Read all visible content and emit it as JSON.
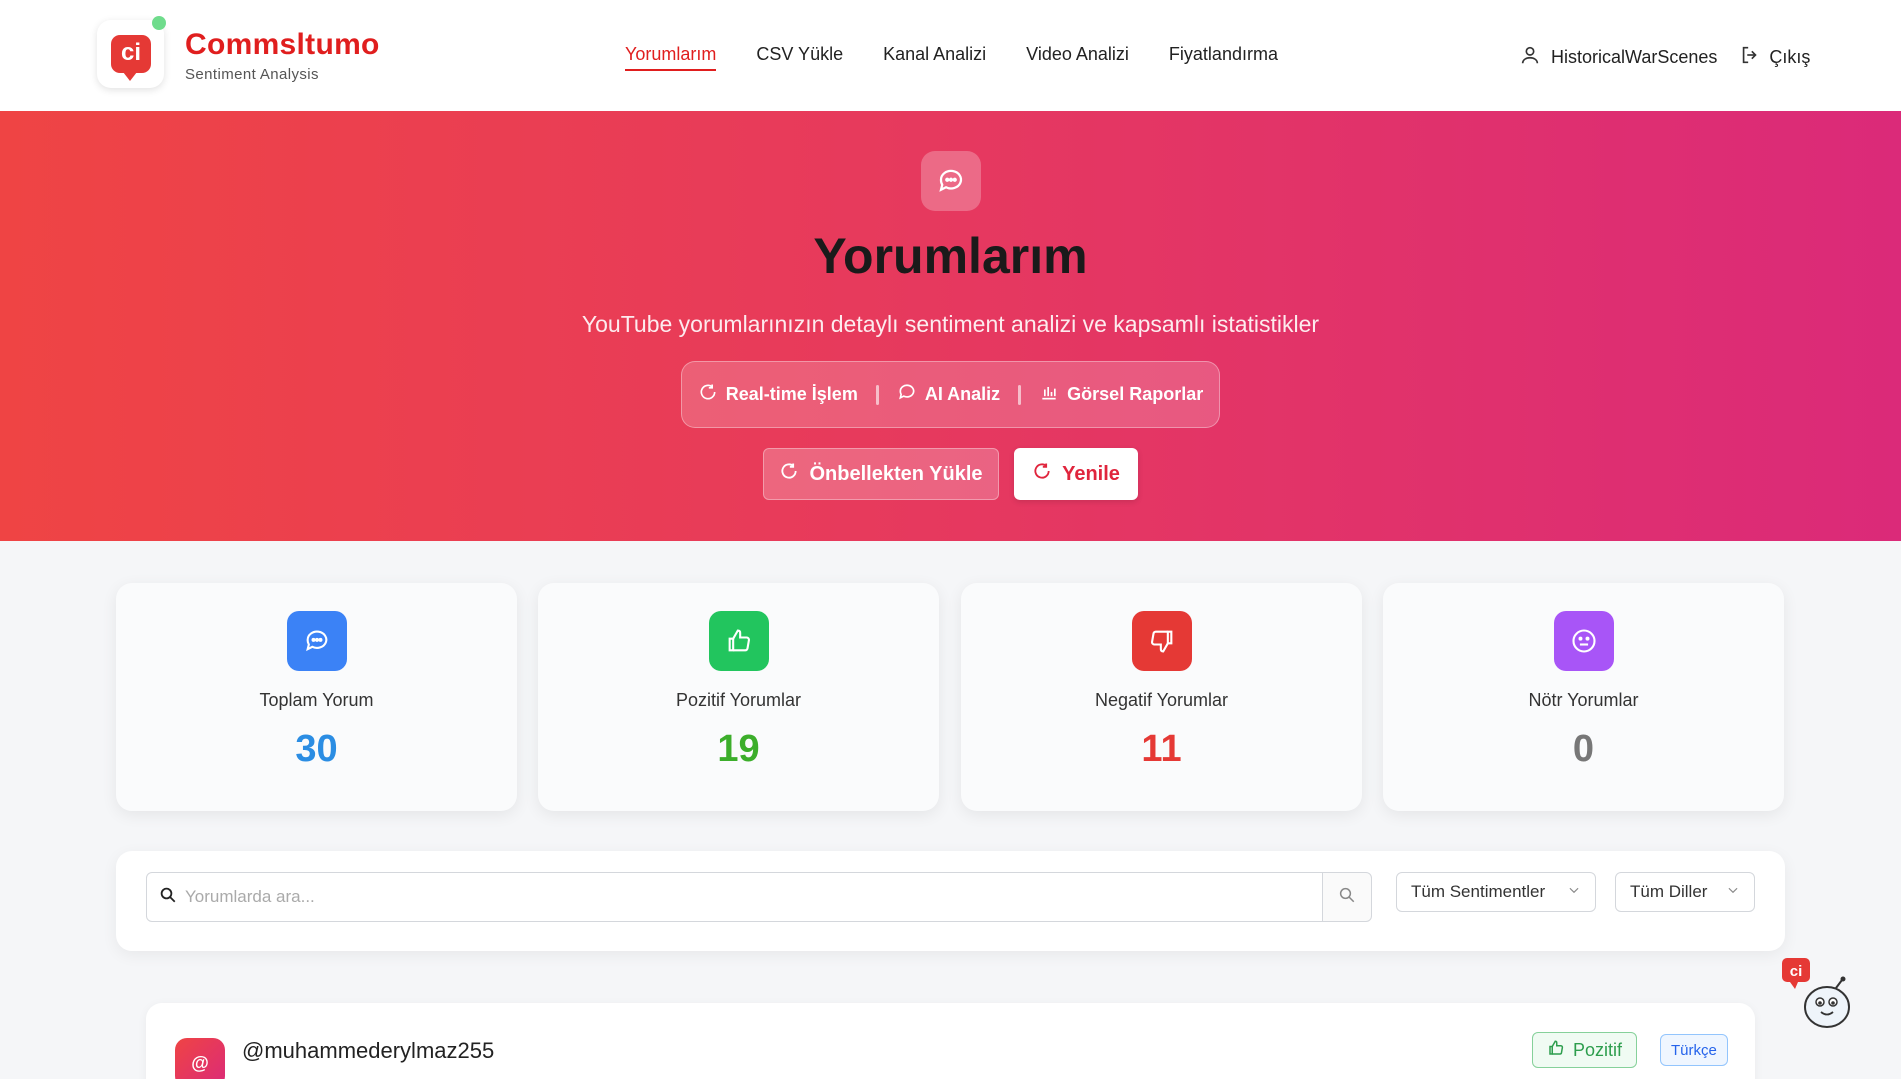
{
  "brand": {
    "name": "Commsltumo",
    "subtitle": "Sentiment Analysis",
    "logo_text": "ci"
  },
  "nav": {
    "items": [
      {
        "label": "Yorumlarım",
        "active": true
      },
      {
        "label": "CSV Yükle",
        "active": false
      },
      {
        "label": "Kanal Analizi",
        "active": false
      },
      {
        "label": "Video Analizi",
        "active": false
      },
      {
        "label": "Fiyatlandırma",
        "active": false
      }
    ]
  },
  "user": {
    "name": "HistoricalWarScenes",
    "logout_label": "Çıkış"
  },
  "hero": {
    "title": "Yorumlarım",
    "subtitle": "YouTube yorumlarınızın detaylı sentiment analizi ve kapsamlı istatistikler",
    "features": [
      "Real-time İşlem",
      "AI Analiz",
      "Görsel Raporlar"
    ],
    "cache_button": "Önbellekten Yükle",
    "refresh_button": "Yenile"
  },
  "stats": [
    {
      "label": "Toplam Yorum",
      "value": "30",
      "color": "#2b8de3",
      "icon_bg": "#3b82f6",
      "icon": "chat-icon"
    },
    {
      "label": "Pozitif Yorumlar",
      "value": "19",
      "color": "#3cae2b",
      "icon_bg": "#22c55e",
      "icon": "thumbs-up-icon"
    },
    {
      "label": "Negatif Yorumlar",
      "value": "11",
      "color": "#e53935",
      "icon_bg": "#e53935",
      "icon": "thumbs-down-icon"
    },
    {
      "label": "Nötr Yorumlar",
      "value": "0",
      "color": "#777777",
      "icon_bg": "#a855f7",
      "icon": "neutral-face-icon"
    }
  ],
  "filters": {
    "search_placeholder": "Yorumlarda ara...",
    "sentiment_select": "Tüm Sentimentler",
    "language_select": "Tüm Diller"
  },
  "comments": [
    {
      "username": "@muhammederylmaz255",
      "avatar": "@",
      "sentiment": "Pozitif",
      "language": "Türkçe"
    }
  ],
  "colors": {
    "accent": "#e01e1e",
    "hero_start": "#ef4444",
    "hero_end": "#db2a79"
  }
}
